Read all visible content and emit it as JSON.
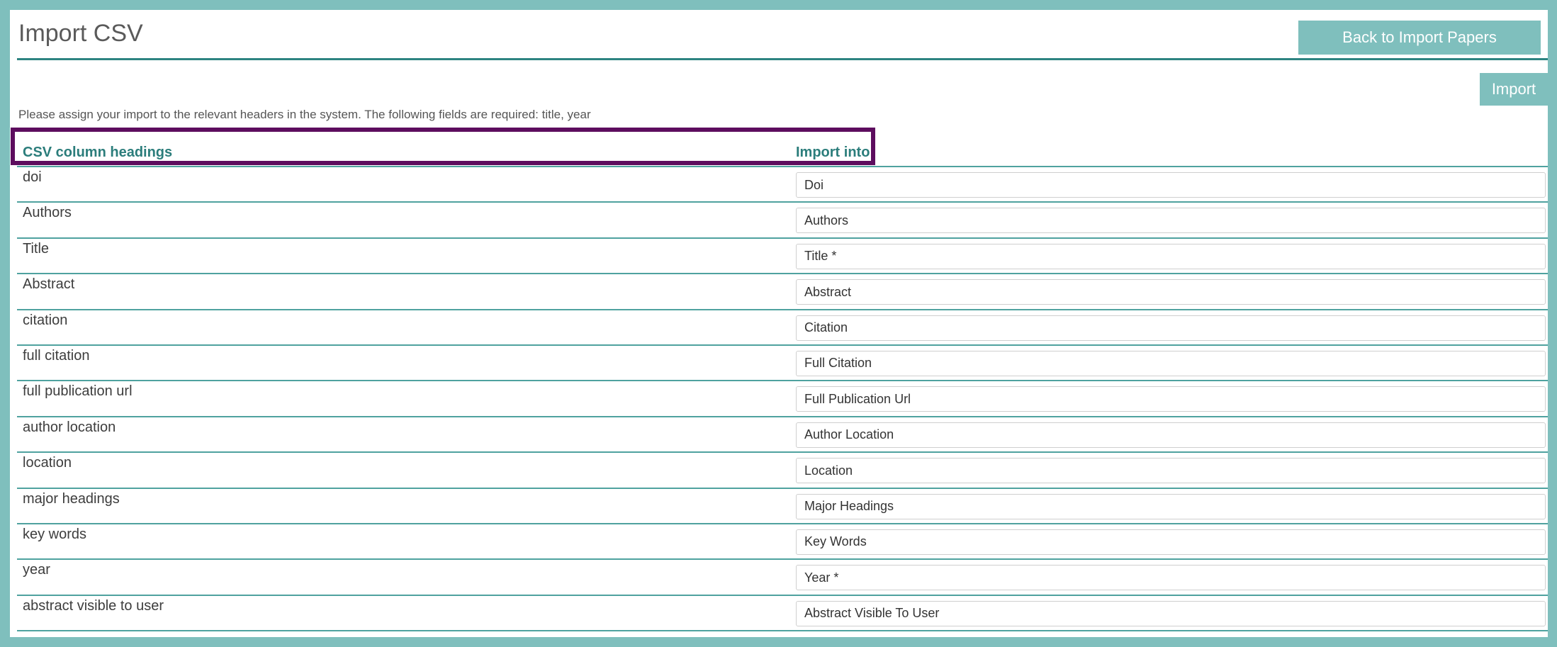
{
  "header": {
    "title": "Import CSV",
    "back_button_label": "Back to Import Papers",
    "import_button_label": "Import"
  },
  "instructions": "Please assign your import to the relevant headers in the system. The following fields are required: title, year",
  "table": {
    "columns": [
      "CSV column headings",
      "Import into"
    ],
    "rows": [
      {
        "heading": "doi",
        "import_into": "Doi"
      },
      {
        "heading": "Authors",
        "import_into": "Authors"
      },
      {
        "heading": "Title",
        "import_into": "Title *"
      },
      {
        "heading": "Abstract",
        "import_into": "Abstract"
      },
      {
        "heading": "citation",
        "import_into": "Citation"
      },
      {
        "heading": "full citation",
        "import_into": "Full Citation"
      },
      {
        "heading": "full publication url",
        "import_into": "Full Publication Url"
      },
      {
        "heading": "author location",
        "import_into": "Author Location"
      },
      {
        "heading": "location",
        "import_into": "Location"
      },
      {
        "heading": "major headings",
        "import_into": "Major Headings"
      },
      {
        "heading": "key words",
        "import_into": "Key Words"
      },
      {
        "heading": "year",
        "import_into": "Year *"
      },
      {
        "heading": "abstract visible to user",
        "import_into": "Abstract Visible To User"
      }
    ]
  },
  "colors": {
    "frame": "#7fbfbd",
    "accent": "#2e8481",
    "header_text": "#2b7d7b",
    "highlight_border": "#5d0d5e"
  }
}
